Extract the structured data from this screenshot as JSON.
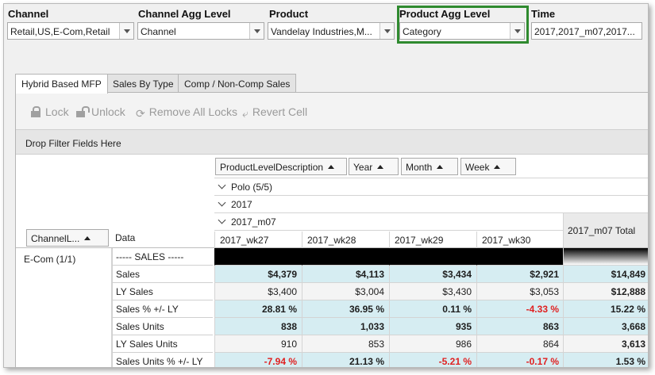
{
  "filters": {
    "channel": {
      "label": "Channel",
      "value": "Retail,US,E-Com,Retail"
    },
    "channel_agg": {
      "label": "Channel Agg Level",
      "value": "Channel"
    },
    "product": {
      "label": "Product",
      "value": "Vandelay Industries,M..."
    },
    "product_agg": {
      "label": "Product Agg Level",
      "value": "Category"
    },
    "time": {
      "label": "Time",
      "value": "2017,2017_m07,2017...",
      "ellipsis": "..."
    }
  },
  "tabs": [
    {
      "label": "Hybrid Based MFP",
      "active": true
    },
    {
      "label": "Sales By Type",
      "active": false
    },
    {
      "label": "Comp / Non-Comp Sales",
      "active": false
    }
  ],
  "toolbar": {
    "lock": "Lock",
    "unlock": "Unlock",
    "remove_all_locks": "Remove All Locks",
    "revert_cell": "Revert Cell"
  },
  "filter_zone_text": "Drop Filter Fields Here",
  "column_fields": [
    "ProductLevelDescription",
    "Year",
    "Month",
    "Week"
  ],
  "row_fields": {
    "channel": "ChannelL...",
    "data": "Data"
  },
  "column_groups": {
    "product": "Polo (5/5)",
    "year": "2017",
    "month": "2017_m07"
  },
  "week_columns": [
    "2017_wk27",
    "2017_wk28",
    "2017_wk29",
    "2017_wk30"
  ],
  "total_column": "2017_m07 Total",
  "channel_row": "E-Com (1/1)",
  "rows": [
    {
      "label": "----- SALES -----",
      "values": [
        "",
        "",
        "",
        ""
      ],
      "total": "",
      "style": "section"
    },
    {
      "label": "Sales",
      "values": [
        "$4,379",
        "$4,113",
        "$3,434",
        "$2,921"
      ],
      "total": "$14,849",
      "style": "bold"
    },
    {
      "label": "LY Sales",
      "values": [
        "$3,400",
        "$3,004",
        "$3,430",
        "$3,053"
      ],
      "total": "$12,888",
      "style": "plain"
    },
    {
      "label": "Sales % +/- LY",
      "values": [
        "28.81 %",
        "36.95 %",
        "0.11 %",
        "-4.33 %"
      ],
      "total": "15.22 %",
      "style": "bold",
      "negatives": [
        false,
        false,
        false,
        true
      ]
    },
    {
      "label": "Sales Units",
      "values": [
        "838",
        "1,033",
        "935",
        "863"
      ],
      "total": "3,668",
      "style": "bold"
    },
    {
      "label": "LY Sales Units",
      "values": [
        "910",
        "853",
        "986",
        "864"
      ],
      "total": "3,613",
      "style": "plain"
    },
    {
      "label": "Sales Units % +/- LY",
      "values": [
        "-7.94 %",
        "21.13 %",
        "-5.21 %",
        "-0.17 %"
      ],
      "total": "1.53 %",
      "style": "bold",
      "negatives": [
        true,
        false,
        true,
        true
      ]
    }
  ],
  "colors": {
    "highlight_box": "#2f8a2f",
    "alt_row": "#d6edf2",
    "negative": "#e02020"
  }
}
